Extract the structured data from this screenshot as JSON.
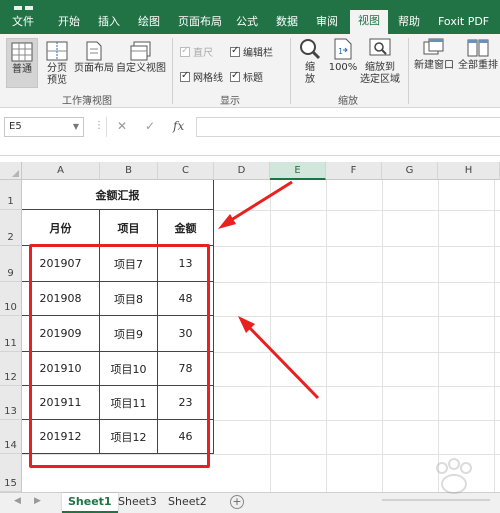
{
  "menu": {
    "items": [
      "文件",
      "开始",
      "插入",
      "绘图",
      "页面布局",
      "公式",
      "数据",
      "审阅",
      "视图",
      "帮助",
      "Foxit PDF"
    ],
    "active": "视图"
  },
  "ribbon": {
    "workbook_views": {
      "normal": "普通",
      "page_break_line1": "分页",
      "page_break_line2": "预览",
      "page_layout": "页面布局",
      "custom_views": "自定义视图",
      "group_label": "工作簿视图"
    },
    "show": {
      "ruler": "直尺",
      "formula_bar": "编辑栏",
      "gridlines": "网格线",
      "headings": "标题",
      "group_label": "显示"
    },
    "zoom": {
      "zoom_line1": "缩",
      "zoom_line2": "放",
      "hundred": "100%",
      "zoom_sel_line1": "缩放到",
      "zoom_sel_line2": "选定区域",
      "group_label": "缩放"
    },
    "window": {
      "new_window": "新建窗口",
      "arrange_all": "全部重排"
    }
  },
  "formula_bar": {
    "name_box": "E5",
    "fx": "fx",
    "formula": ""
  },
  "grid": {
    "columns": [
      "A",
      "B",
      "C",
      "D",
      "E",
      "F",
      "G",
      "H"
    ],
    "selected_column": "E",
    "row_numbers": [
      "1",
      "2",
      "9",
      "10",
      "11",
      "12",
      "13",
      "14",
      "15"
    ],
    "table_title": "金额汇报",
    "headers": [
      "月份",
      "项目",
      "金额"
    ],
    "rows": [
      [
        "201907",
        "项目7",
        "13"
      ],
      [
        "201908",
        "项目8",
        "48"
      ],
      [
        "201909",
        "项目9",
        "30"
      ],
      [
        "201910",
        "项目10",
        "78"
      ],
      [
        "201911",
        "项目11",
        "23"
      ],
      [
        "201912",
        "项目12",
        "46"
      ]
    ]
  },
  "annotation_color": "#e8201f",
  "accent_color": "#217346",
  "sheets": {
    "tabs": [
      "Sheet1",
      "Sheet3",
      "Sheet2"
    ],
    "active": "Sheet1",
    "add": "+"
  }
}
